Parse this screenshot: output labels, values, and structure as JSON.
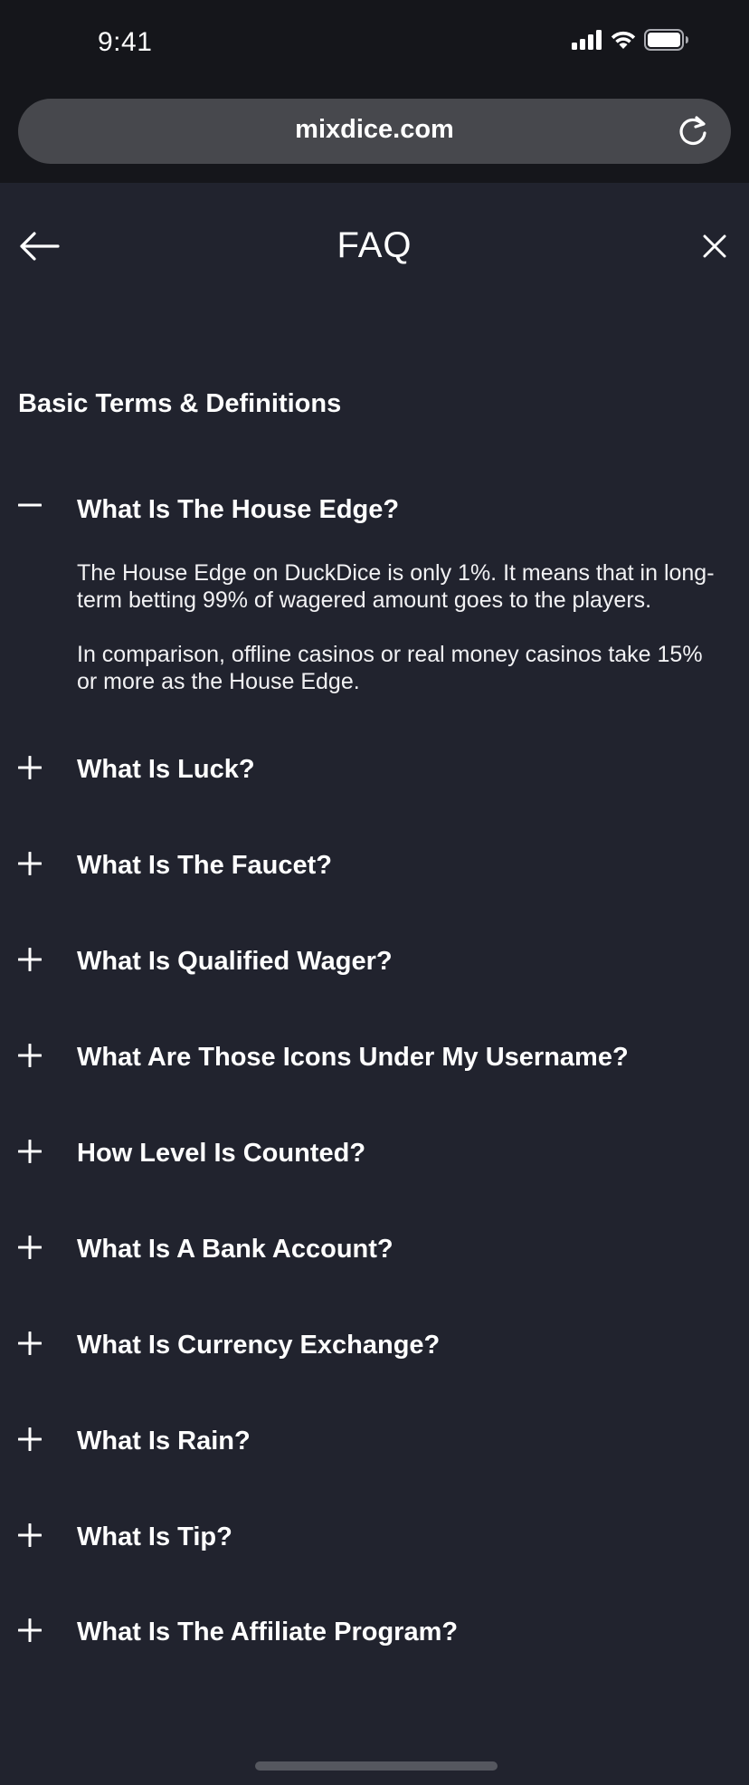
{
  "status_bar": {
    "time": "9:41",
    "icons": [
      "cellular-signal-icon",
      "wifi-icon",
      "battery-icon"
    ]
  },
  "browser": {
    "url": "mixdice.com",
    "reload_icon": "reload-icon"
  },
  "header": {
    "title": "FAQ",
    "back_icon": "arrow-left-icon",
    "close_icon": "close-icon"
  },
  "section": {
    "title": "Basic Terms & Definitions"
  },
  "faq": [
    {
      "question": "What Is The House Edge?",
      "expanded": true,
      "answer": [
        "The House Edge on DuckDice is only 1%. It means that in long-term betting 99% of wagered amount goes to the players.",
        "In comparison, offline casinos or real money casinos take 15% or more as the House Edge."
      ]
    },
    {
      "question": "What Is Luck?",
      "expanded": false
    },
    {
      "question": "What Is The Faucet?",
      "expanded": false
    },
    {
      "question": "What Is Qualified Wager?",
      "expanded": false
    },
    {
      "question": "What Are Those Icons Under My Username?",
      "expanded": false
    },
    {
      "question": "How Level Is Counted?",
      "expanded": false
    },
    {
      "question": "What Is A Bank Account?",
      "expanded": false
    },
    {
      "question": "What Is Currency Exchange?",
      "expanded": false
    },
    {
      "question": "What Is Rain?",
      "expanded": false
    },
    {
      "question": "What Is Tip?",
      "expanded": false
    },
    {
      "question": "What Is The Affiliate Program?",
      "expanded": false
    }
  ],
  "colors": {
    "background": "#21232e",
    "chrome": "#15161b",
    "url_bar": "#47484d",
    "text": "#ffffff"
  }
}
